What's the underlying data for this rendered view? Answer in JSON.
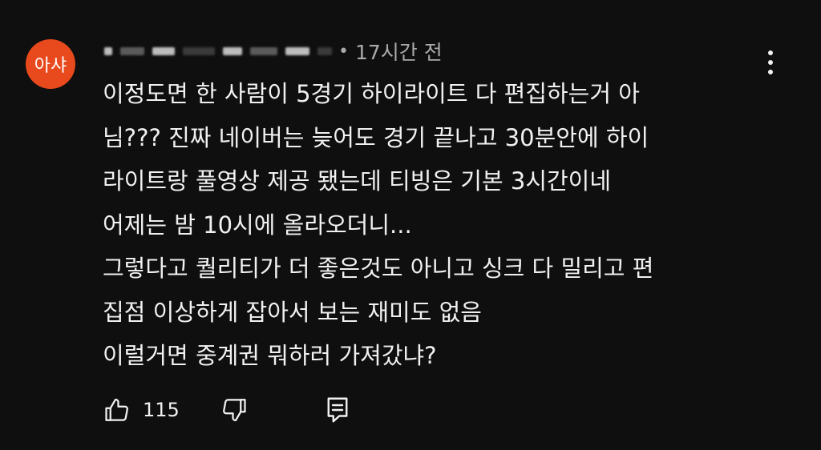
{
  "comment": {
    "avatar_text": "아샤",
    "avatar_color": "#e8491d",
    "separator": "•",
    "timestamp": "17시간 전",
    "body_lines": [
      "이정도면 한 사람이 5경기 하이라이트 다 편집하는거 아",
      "님??? 진짜 네이버는 늦어도 경기 끝나고 30분안에 하이",
      "라이트랑 풀영상 제공 됐는데 티빙은 기본 3시간이네",
      "어제는 밤 10시에 올라오더니...",
      "그렇다고 퀄리티가 더 좋은것도 아니고 싱크 다 밀리고 편",
      "집점 이상하게 잡아서 보는 재미도 없음",
      "이럴거면 중계권 뭐하러 가져갔냐?"
    ],
    "like_count": "115",
    "icons": {
      "like": "thumbs-up-icon",
      "dislike": "thumbs-down-icon",
      "reply": "reply-icon",
      "more": "more-vert-icon"
    }
  }
}
